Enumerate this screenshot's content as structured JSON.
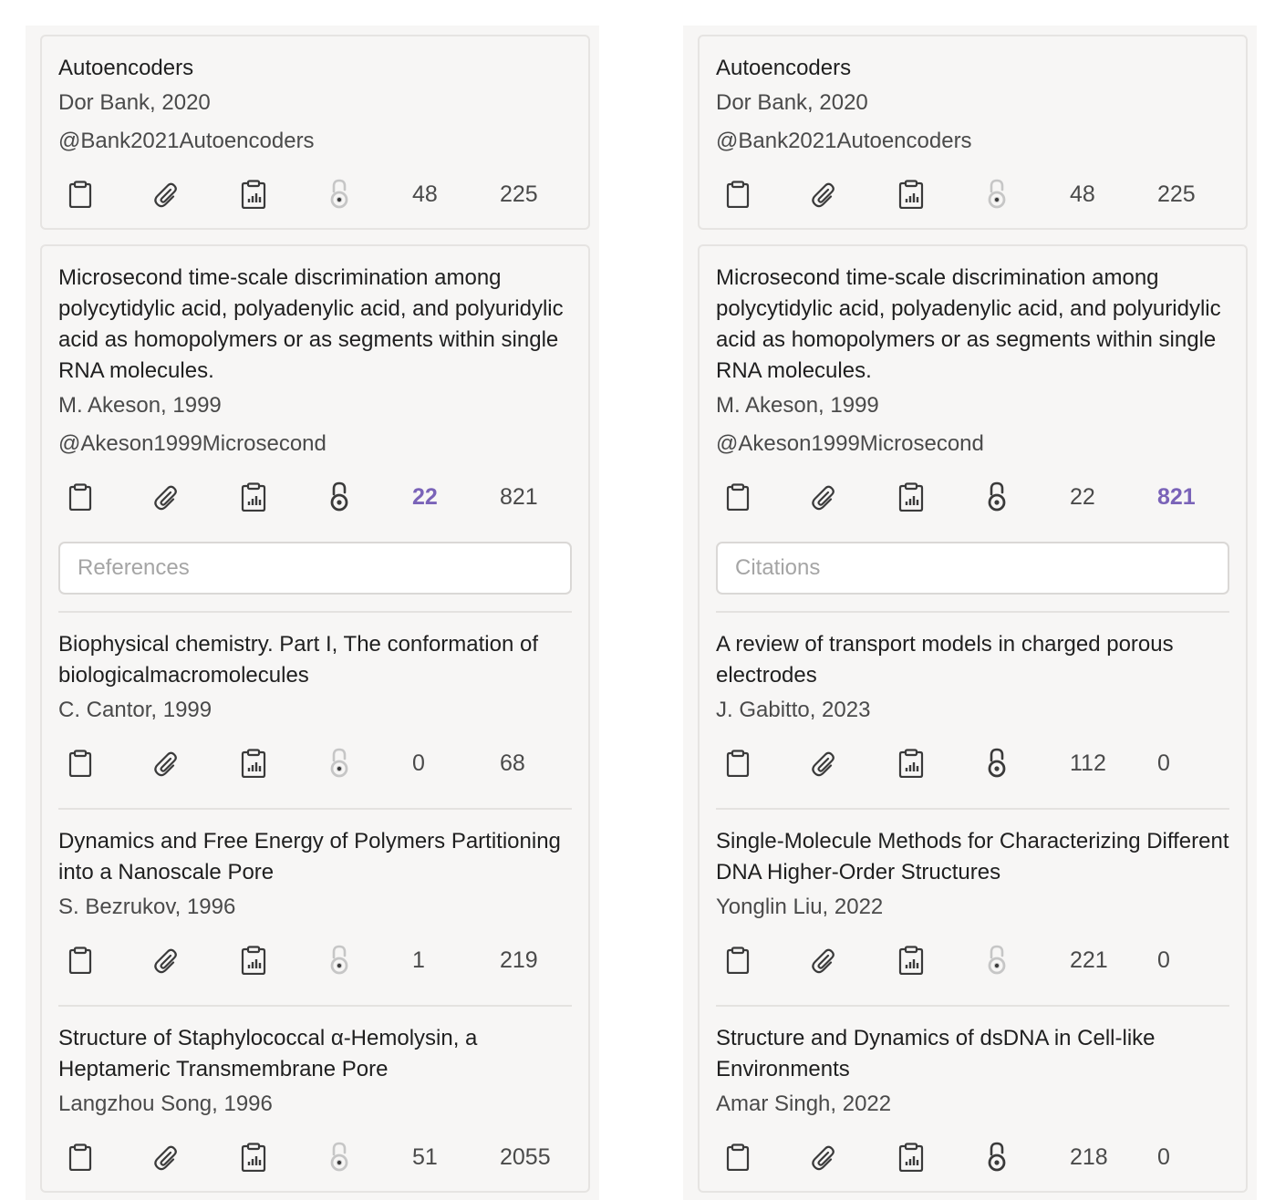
{
  "colors": {
    "accent": "#7a63b8",
    "panel_bg": "#f7f6f5",
    "border": "#e6e4e2"
  },
  "left": {
    "top_card": {
      "title": "Autoencoders",
      "meta": "Dor Bank, 2020",
      "key": "@Bank2021Autoencoders",
      "references": "48",
      "citations": "225",
      "open_access": false
    },
    "main_card": {
      "title": "Microsecond time-scale discrimination among polycytidylic acid, polyadenylic acid, and polyuridylic acid as homopolymers or as segments within single RNA molecules.",
      "meta": "M. Akeson, 1999",
      "key": "@Akeson1999Microsecond",
      "references": "22",
      "citations": "821",
      "open_access": true,
      "active": "references",
      "search_placeholder": "References",
      "items": [
        {
          "title": "Biophysical chemistry. Part I, The conformation of biologicalmacromolecules",
          "meta": "C. Cantor, 1999",
          "references": "0",
          "citations": "68",
          "open_access": false
        },
        {
          "title": "Dynamics and Free Energy of Polymers Partitioning into a Nanoscale Pore",
          "meta": "S. Bezrukov, 1996",
          "references": "1",
          "citations": "219",
          "open_access": false
        },
        {
          "title": "Structure of Staphylococcal α-Hemolysin, a Heptameric Transmembrane Pore",
          "meta": "Langzhou Song, 1996",
          "references": "51",
          "citations": "2055",
          "open_access": false
        }
      ]
    }
  },
  "right": {
    "top_card": {
      "title": "Autoencoders",
      "meta": "Dor Bank, 2020",
      "key": "@Bank2021Autoencoders",
      "references": "48",
      "citations": "225",
      "open_access": false
    },
    "main_card": {
      "title": "Microsecond time-scale discrimination among polycytidylic acid, polyadenylic acid, and polyuridylic acid as homopolymers or as segments within single RNA molecules.",
      "meta": "M. Akeson, 1999",
      "key": "@Akeson1999Microsecond",
      "references": "22",
      "citations": "821",
      "open_access": true,
      "active": "citations",
      "search_placeholder": "Citations",
      "items": [
        {
          "title": "A review of transport models in charged porous electrodes",
          "meta": "J. Gabitto, 2023",
          "references": "112",
          "citations": "0",
          "open_access": true
        },
        {
          "title": "Single-Molecule Methods for Characterizing Different DNA Higher-Order Structures",
          "meta": "Yonglin Liu, 2022",
          "references": "221",
          "citations": "0",
          "open_access": false
        },
        {
          "title": "Structure and Dynamics of dsDNA in Cell-like Environments",
          "meta": "Amar Singh, 2022",
          "references": "218",
          "citations": "0",
          "open_access": true
        }
      ]
    }
  }
}
